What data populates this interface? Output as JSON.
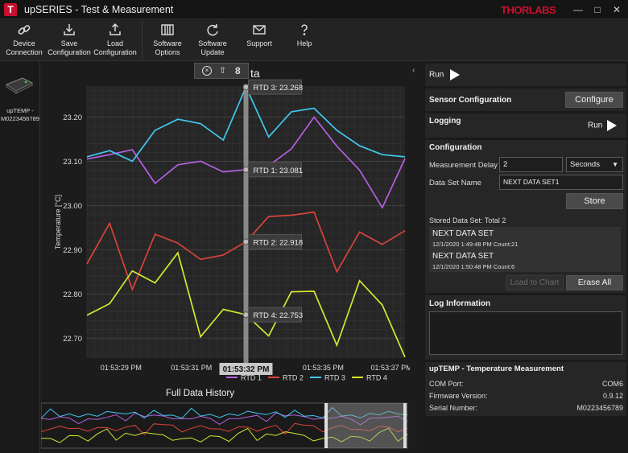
{
  "window": {
    "title": "upSERIES - Test & Measurement",
    "brand": "THORLABS",
    "app_icon": "T"
  },
  "toolbar": {
    "items": [
      {
        "label1": "Device",
        "label2": "Connection",
        "icon": "link-icon"
      },
      {
        "label1": "Save",
        "label2": "Configuration",
        "icon": "save-icon"
      },
      {
        "label1": "Load",
        "label2": "Configuration",
        "icon": "load-icon"
      },
      {
        "label1": "Software",
        "label2": "Options",
        "icon": "options-icon"
      },
      {
        "label1": "Software",
        "label2": "Update",
        "icon": "update-icon"
      },
      {
        "label1": "Support",
        "label2": "",
        "icon": "mail-icon"
      },
      {
        "label1": "Help",
        "label2": "",
        "icon": "help-icon"
      }
    ]
  },
  "device": {
    "name": "upTEMP -",
    "serial": "M0223456789"
  },
  "chart_title_fragment": "ta",
  "chart_data": {
    "type": "line",
    "ylabel": "Temperature [°C]",
    "ylim": [
      22.655,
      23.27
    ],
    "yticks": [
      "23.20",
      "23.10",
      "23.00",
      "22.90",
      "22.80",
      "22.70"
    ],
    "xticks": [
      "01:53:29 PM",
      "01:53:31 PM",
      "01:53:35 PM",
      "01:53:37 PM"
    ],
    "series": [
      {
        "name": "RTD 1",
        "color": "#b460e0",
        "values": [
          23.105,
          23.115,
          23.126,
          23.05,
          23.092,
          23.1,
          23.076,
          23.081,
          23.09,
          23.128,
          23.2,
          23.134,
          23.08,
          22.995,
          23.106
        ]
      },
      {
        "name": "RTD 2",
        "color": "#d9433b",
        "values": [
          22.868,
          22.96,
          22.81,
          22.935,
          22.915,
          22.878,
          22.888,
          22.918,
          22.975,
          22.978,
          22.985,
          22.85,
          22.94,
          22.912,
          22.943
        ]
      },
      {
        "name": "RTD 3",
        "color": "#40c8f0",
        "values": [
          23.11,
          23.124,
          23.1,
          23.17,
          23.195,
          23.185,
          23.148,
          23.268,
          23.155,
          23.212,
          23.22,
          23.17,
          23.135,
          23.115,
          23.11
        ]
      },
      {
        "name": "RTD 4",
        "color": "#d4e830",
        "values": [
          22.752,
          22.778,
          22.852,
          22.825,
          22.893,
          22.703,
          22.765,
          22.753,
          22.705,
          22.805,
          22.806,
          22.684,
          22.83,
          22.775,
          22.657
        ]
      }
    ],
    "cursor": {
      "time": "01:53:32 PM",
      "index": 7
    },
    "tooltips": [
      "RTD 3: 23.268",
      "RTD 1: 23.081",
      "RTD 2: 22.918",
      "RTD 4: 22.753"
    ],
    "history_title": "Full Data History"
  },
  "right": {
    "run_label": "Run",
    "sensor_config_title": "Sensor Configuration",
    "configure_label": "Configure",
    "logging_title": "Logging",
    "logging_run_label": "Run",
    "configuration_title": "Configuration",
    "measurement_delay_label": "Measurement Delay",
    "measurement_delay_value": "2",
    "delay_unit": "Seconds",
    "dataset_name_label": "Data Set Name",
    "dataset_name_value": "NEXT DATA SET1",
    "store_label": "Store",
    "stored_label": "Stored Data Set: Total 2",
    "datasets": [
      {
        "name": "NEXT DATA SET",
        "meta": "12/1/2020 1:49:48 PM  Count:21"
      },
      {
        "name": "NEXT DATA SET",
        "meta": "12/1/2020 1:50:48 PM  Count:6"
      }
    ],
    "load_to_chart_label": "Load to Chart",
    "erase_all_label": "Erase All",
    "log_info_title": "Log Information",
    "device_info_title": "upTEMP - Temperature Measurement",
    "com_port_label": "COM Port:",
    "com_port_value": "COM6",
    "firmware_label": "Firmware Version:",
    "firmware_value": "0.9.12",
    "serial_label": "Serial Number:",
    "serial_value": "M0223456789"
  }
}
